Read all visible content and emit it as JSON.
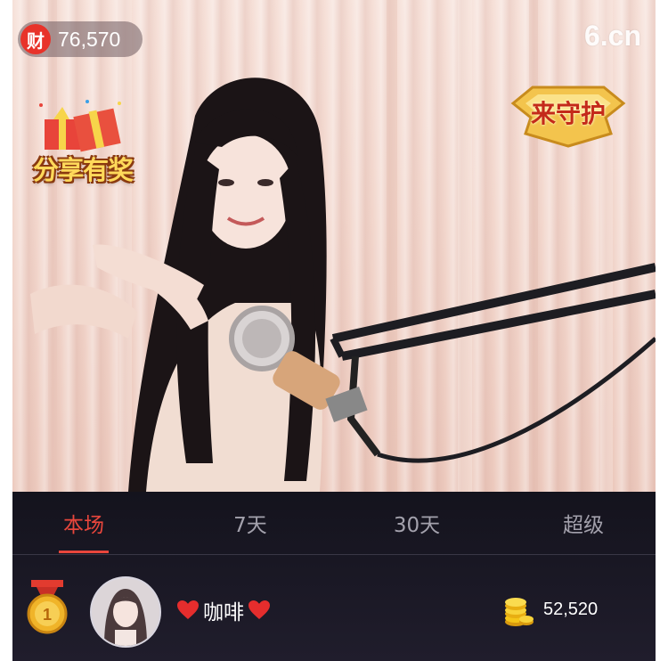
{
  "colors": {
    "accent": "#e8463c",
    "panel_bg": "#1a1824",
    "tab_inactive": "#a3a1ac"
  },
  "video": {
    "wealth_icon_label": "财",
    "wealth_value": "76,570",
    "logo_text": "6.cn",
    "share_reward_label": "分享有奖",
    "guard_label": "来守护"
  },
  "tabs": [
    {
      "label": "本场",
      "active": true
    },
    {
      "label": "7天",
      "active": false
    },
    {
      "label": "30天",
      "active": false
    },
    {
      "label": "超级",
      "active": false
    }
  ],
  "ranking": [
    {
      "rank_icon": "gold-medal-icon",
      "rank": "1",
      "name": "咖啡",
      "name_decoration": "heart-icon",
      "score_icon": "gold-coins-icon",
      "score": "52,520"
    }
  ]
}
